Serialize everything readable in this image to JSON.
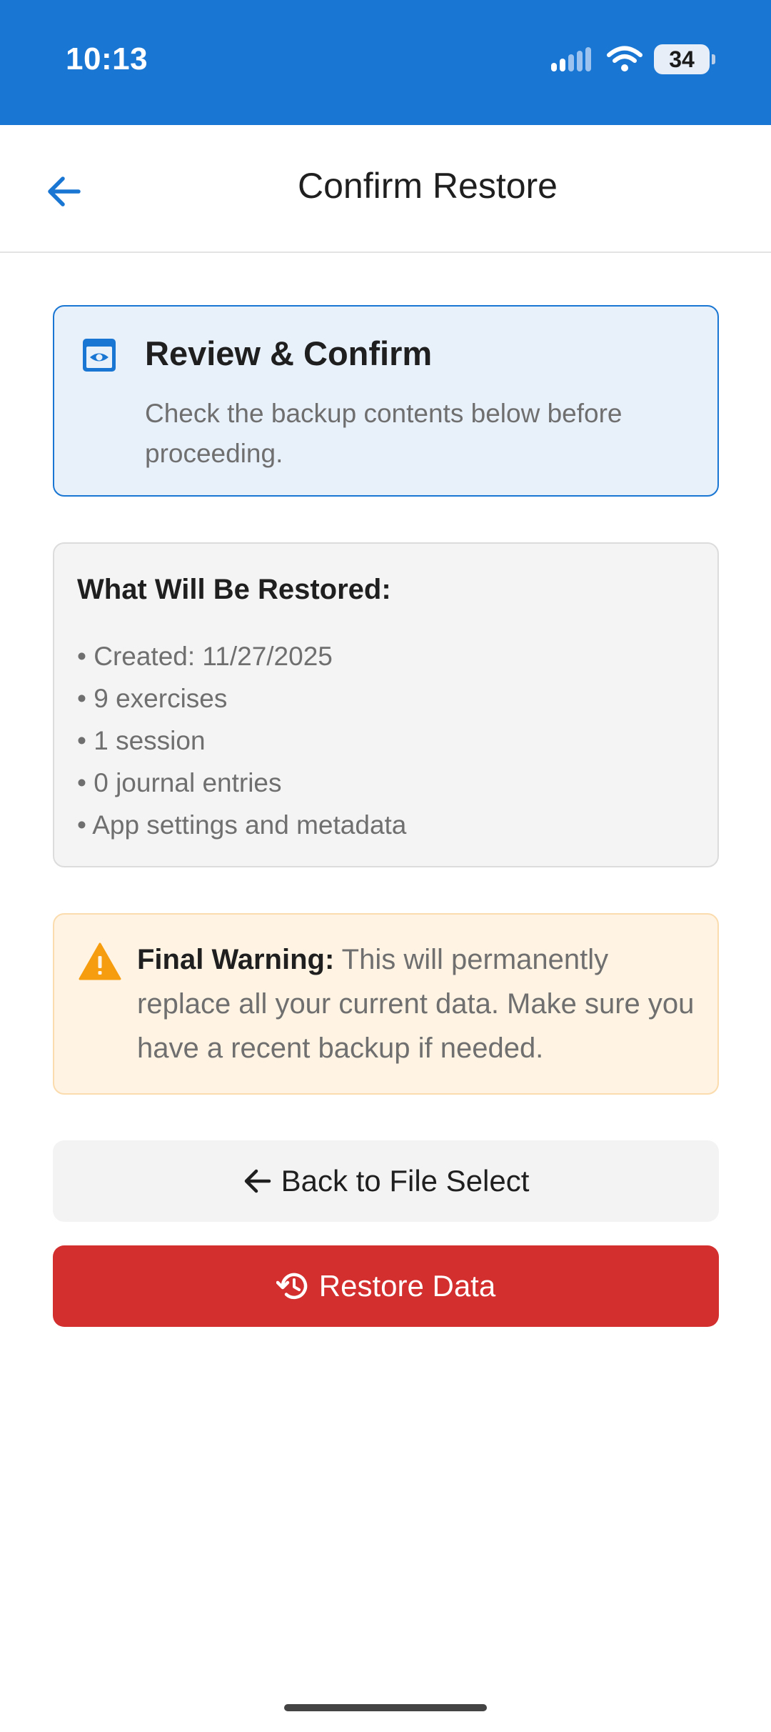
{
  "status_bar": {
    "time": "10:13",
    "battery": "34",
    "background_color": "#1976d2",
    "icons": [
      "signal-icon",
      "wifi-icon",
      "battery-icon"
    ]
  },
  "header": {
    "title": "Confirm Restore",
    "back_icon": "arrow-back-icon"
  },
  "review_card": {
    "icon": "preview-eye-icon",
    "title": "Review & Confirm",
    "description": "Check the backup contents below before proceeding.",
    "accent_color": "#1976d2"
  },
  "restore_summary": {
    "title": "What Will Be Restored:",
    "items": [
      "• Created: 11/27/2025",
      "• 9 exercises",
      "• 1 session",
      "• 0 journal entries",
      "• App settings and metadata"
    ]
  },
  "warning": {
    "icon": "warning-triangle-icon",
    "label": "Final Warning:",
    "text": " This will permanently replace all your current data. Make sure you have a recent backup if needed.",
    "accent_color": "#f59c0f"
  },
  "actions": {
    "back_label": "Back to File Select",
    "back_icon": "arrow-back-icon",
    "restore_label": "Restore Data",
    "restore_icon": "history-restore-icon",
    "restore_color": "#d32f2f"
  }
}
